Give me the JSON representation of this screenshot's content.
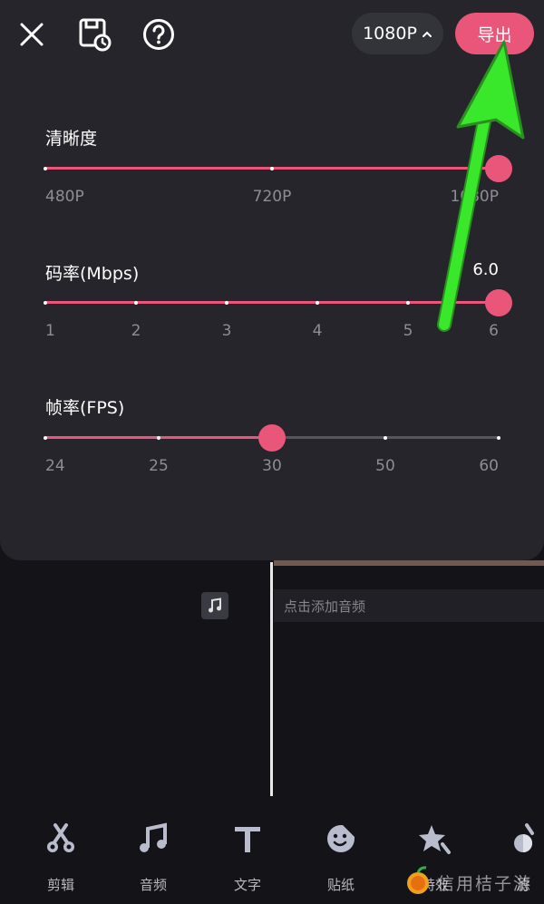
{
  "header": {
    "resolution_label": "1080P",
    "export_label": "导出"
  },
  "icons": {
    "close": "close-icon",
    "save_draft": "save-clock-icon",
    "help": "help-icon",
    "chevron": "chevron-up-icon"
  },
  "resolution": {
    "label": "清晰度",
    "ticks": [
      "480P",
      "720P",
      "1080P"
    ],
    "selected_index": 2
  },
  "bitrate": {
    "label": "码率(Mbps)",
    "value": "6.0",
    "ticks": [
      "1",
      "2",
      "3",
      "4",
      "5",
      "6"
    ],
    "selected_index": 5
  },
  "framerate": {
    "label": "帧率(FPS)",
    "ticks": [
      "24",
      "25",
      "30",
      "50",
      "60"
    ],
    "selected_index": 2
  },
  "timeline": {
    "add_audio_hint": "点击添加音频"
  },
  "toolbar": {
    "items": [
      {
        "label": "剪辑",
        "icon": "scissors-icon"
      },
      {
        "label": "音频",
        "icon": "music-note-icon"
      },
      {
        "label": "文字",
        "icon": "text-icon"
      },
      {
        "label": "贴纸",
        "icon": "sticker-icon"
      },
      {
        "label": "特效",
        "icon": "star-effect-icon"
      },
      {
        "label": "滤",
        "icon": "filter-icon"
      }
    ]
  },
  "colors": {
    "accent": "#e9567a",
    "sheet": "#25252b",
    "background": "#141418",
    "annotation_arrow": "#39e82a"
  },
  "watermark": {
    "text": "信用桔子游"
  }
}
